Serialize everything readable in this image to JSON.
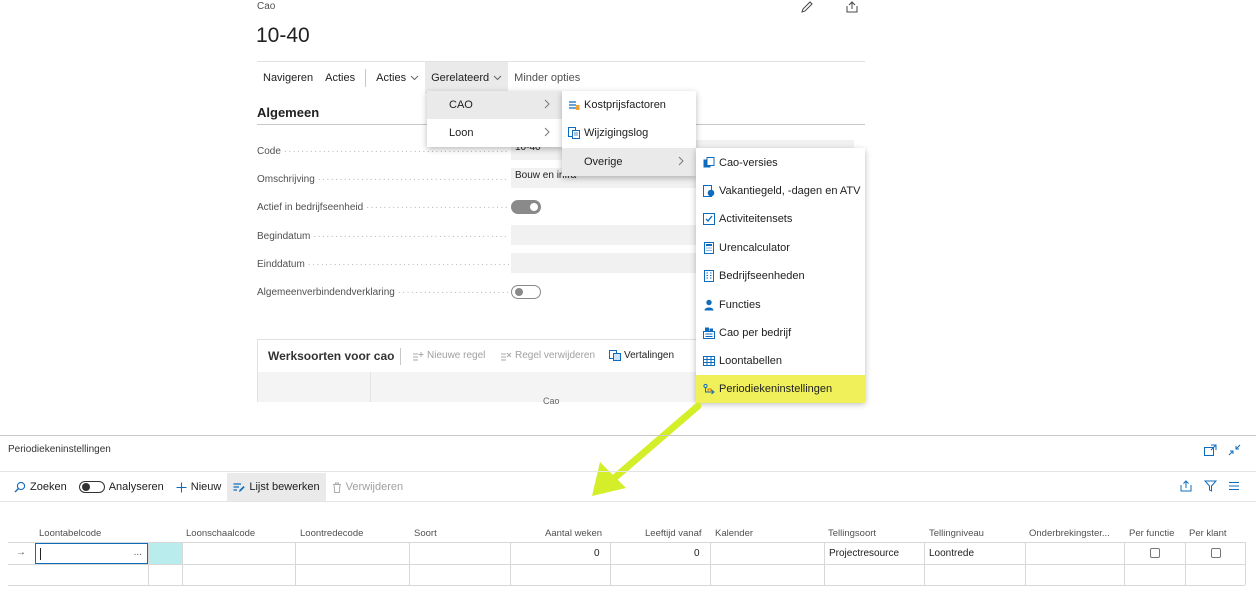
{
  "card": {
    "breadcrumb": "Cao",
    "title": "10-40",
    "actions": [
      "Navigeren",
      "Acties",
      "Acties",
      "Gerelateerd",
      "Minder opties"
    ],
    "group_title": "Algemeen",
    "fields": {
      "code": {
        "label": "Code",
        "value": "10-40"
      },
      "omschrijving": {
        "label": "Omschrijving",
        "value": "Bouw en infra"
      },
      "actief": {
        "label": "Actief in bedrijfseenheid",
        "value": true
      },
      "begindatum": {
        "label": "Begindatum",
        "value": ""
      },
      "einddatum": {
        "label": "Einddatum",
        "value": ""
      },
      "avv": {
        "label": "Algemeenverbindendverklaring",
        "value": false
      }
    },
    "part": {
      "title": "Werksoorten voor cao",
      "actions": [
        "Nieuwe regel",
        "Regel verwijderen",
        "Vertalingen"
      ],
      "cut_text": "Cao"
    }
  },
  "menus": {
    "level1": [
      "CAO",
      "Loon"
    ],
    "level2": [
      "Kostprijsfactoren",
      "Wijzigingslog",
      "Overige"
    ],
    "level3": [
      "Cao-versies",
      "Vakantiegeld, -dagen en ATV",
      "Activiteitensets",
      "Urencalculator",
      "Bedrijfseenheden",
      "Functies",
      "Cao per bedrijf",
      "Loontabellen",
      "Periodiekeninstellingen"
    ]
  },
  "list": {
    "title": "Periodiekeninstellingen",
    "actions": {
      "search": "Zoeken",
      "analyse": "Analyseren",
      "new": "Nieuw",
      "edit_list": "Lijst bewerken",
      "delete": "Verwijderen"
    },
    "columns": [
      "Loontabelcode",
      "Loonschaalcode",
      "Loontredecode",
      "Soort",
      "Aantal weken",
      "Leeftijd vanaf",
      "Kalender",
      "Tellingsoort",
      "Tellingniveau",
      "Onderbrekingster...",
      "Per functie",
      "Per klant"
    ],
    "rows": [
      {
        "loontabelcode": "",
        "loonschaalcode": "",
        "loontredecode": "",
        "soort": "",
        "aantal_weken": "0",
        "leeftijd_vanaf": "0",
        "kalender": "",
        "tellingsoort": "Projectresource",
        "tellingniveau": "Loontrede",
        "onderbreking": "",
        "per_functie": false,
        "per_klant": false
      }
    ],
    "lookup_glyph": "...",
    "row_marker": "→"
  },
  "colors": {
    "highlight": "#f0f05a",
    "arrow": "#d4ef2a",
    "accent_teal": "#b9ecec",
    "brand_blue": "#0f6cbd"
  }
}
